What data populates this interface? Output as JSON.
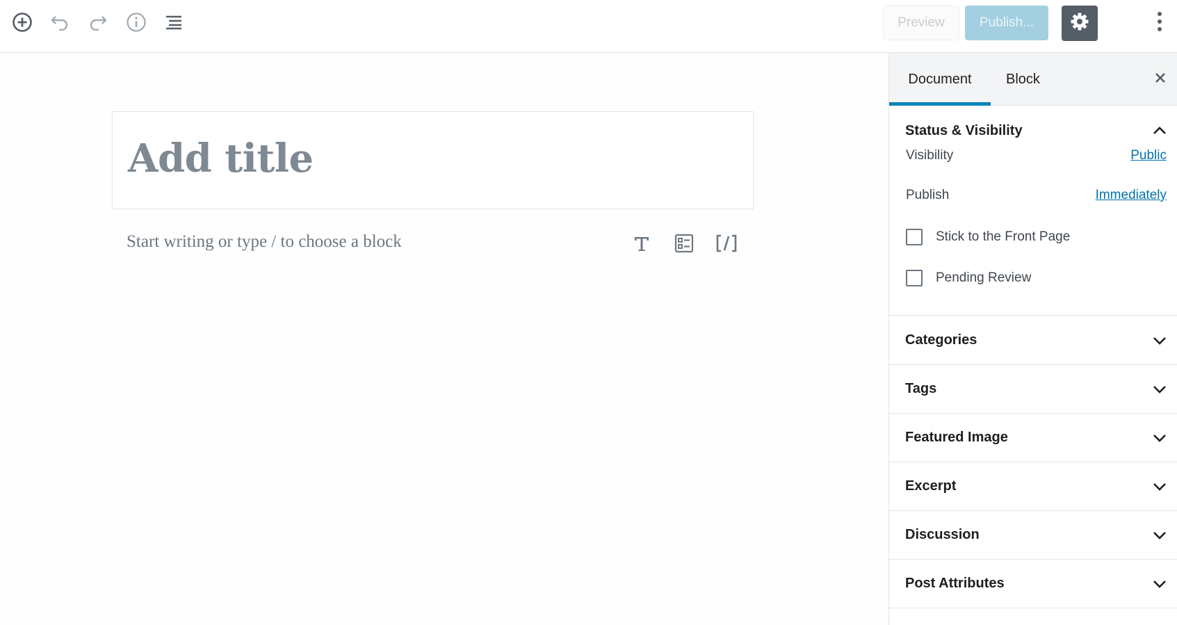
{
  "toolbar": {
    "icons": [
      "add-block-icon",
      "undo-icon",
      "redo-icon",
      "info-icon",
      "block-navigation-icon"
    ],
    "preview_label": "Preview",
    "publish_label": "Publish...",
    "settings_icon": "gear-icon",
    "more_icon": "more-vertical-icon"
  },
  "editor": {
    "title_placeholder": "Add title",
    "paragraph_placeholder": "Start writing or type / to choose a block",
    "block_shortcuts": [
      "paragraph-icon",
      "image-text-icon",
      "shortcode-icon"
    ]
  },
  "sidebar": {
    "tabs": [
      {
        "label": "Document",
        "active": true
      },
      {
        "label": "Block",
        "active": false
      }
    ],
    "close_icon": "close-icon",
    "status_panel": {
      "title": "Status & Visibility",
      "expanded": true,
      "visibility_label": "Visibility",
      "visibility_value": "Public",
      "publish_label": "Publish",
      "publish_value": "Immediately",
      "checkboxes": [
        {
          "label": "Stick to the Front Page",
          "checked": false
        },
        {
          "label": "Pending Review",
          "checked": false
        }
      ]
    },
    "panels": [
      {
        "title": "Categories"
      },
      {
        "title": "Tags"
      },
      {
        "title": "Featured Image"
      },
      {
        "title": "Excerpt"
      },
      {
        "title": "Discussion"
      },
      {
        "title": "Post Attributes"
      }
    ]
  },
  "colors": {
    "accent": "#0085ba",
    "link": "#0073aa",
    "publish_disabled": "#a3cfe0",
    "settings_active": "#555d66"
  }
}
